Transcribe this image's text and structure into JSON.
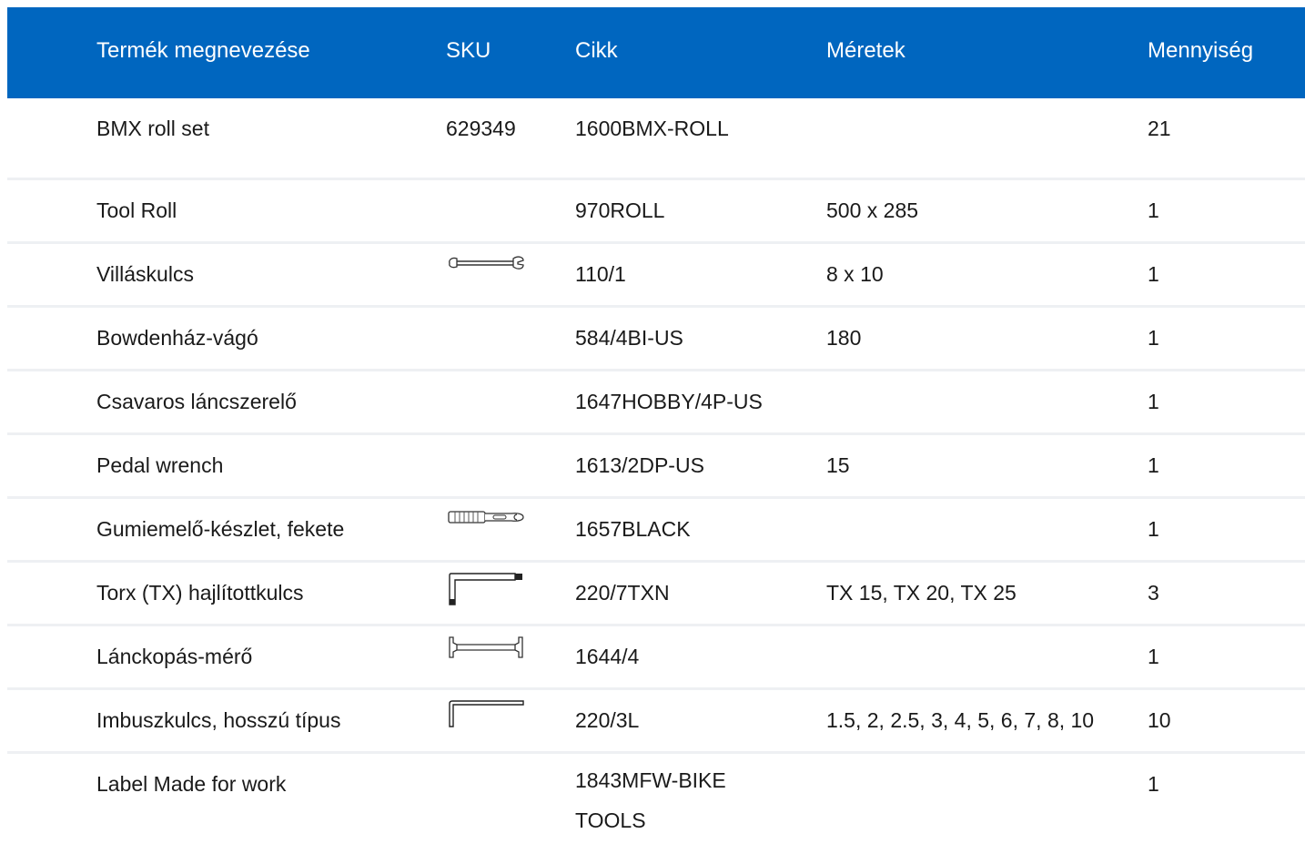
{
  "table": {
    "headers": [
      "Termék megnevezése",
      "SKU",
      "Cikk",
      "Méretek",
      "Mennyiség"
    ],
    "rows": [
      {
        "name": "BMX roll set",
        "sku": "629349",
        "cikk": "1600BMX-ROLL",
        "meretek": "",
        "qty": "21",
        "icon": ""
      },
      {
        "name": "Tool Roll",
        "sku": "",
        "cikk": "970ROLL",
        "meretek": "500 x 285",
        "qty": "1",
        "icon": ""
      },
      {
        "name": "Villáskulcs",
        "sku": "",
        "cikk": "110/1",
        "meretek": "8 x 10",
        "qty": "1",
        "icon": "open-end-wrench-icon"
      },
      {
        "name": "Bowdenház-vágó",
        "sku": "",
        "cikk": "584/4BI-US",
        "meretek": "180",
        "qty": "1",
        "icon": ""
      },
      {
        "name": "Csavaros láncszerelő",
        "sku": "",
        "cikk": "1647HOBBY/4P-US",
        "meretek": "",
        "qty": "1",
        "icon": ""
      },
      {
        "name": "Pedal wrench",
        "sku": "",
        "cikk": "1613/2DP-US",
        "meretek": "15",
        "qty": "1",
        "icon": ""
      },
      {
        "name": "Gumiemelő-készlet, fekete",
        "sku": "",
        "cikk": "1657BLACK",
        "meretek": "",
        "qty": "1",
        "icon": "tire-lever-icon"
      },
      {
        "name": "Torx (TX) hajlítottkulcs",
        "sku": "",
        "cikk": "220/7TXN",
        "meretek": "TX 15, TX 20, TX 25",
        "qty": "3",
        "icon": "torx-key-icon"
      },
      {
        "name": "Lánckopás-mérő",
        "sku": "",
        "cikk": "1644/4",
        "meretek": "",
        "qty": "1",
        "icon": "chain-checker-icon"
      },
      {
        "name": "Imbuszkulcs, hosszú típus",
        "sku": "",
        "cikk": "220/3L",
        "meretek": "1.5, 2, 2.5, 3, 4, 5, 6, 7, 8, 10",
        "qty": "10",
        "icon": "hex-key-icon"
      },
      {
        "name": "Label Made for work",
        "sku": "",
        "cikk": "1843MFW-BIKE TOOLS",
        "meretek": "",
        "qty": "1",
        "icon": ""
      }
    ]
  },
  "colors": {
    "header_bg": "#0066bf",
    "header_text": "#ffffff",
    "row_divider": "#eef0f3"
  }
}
